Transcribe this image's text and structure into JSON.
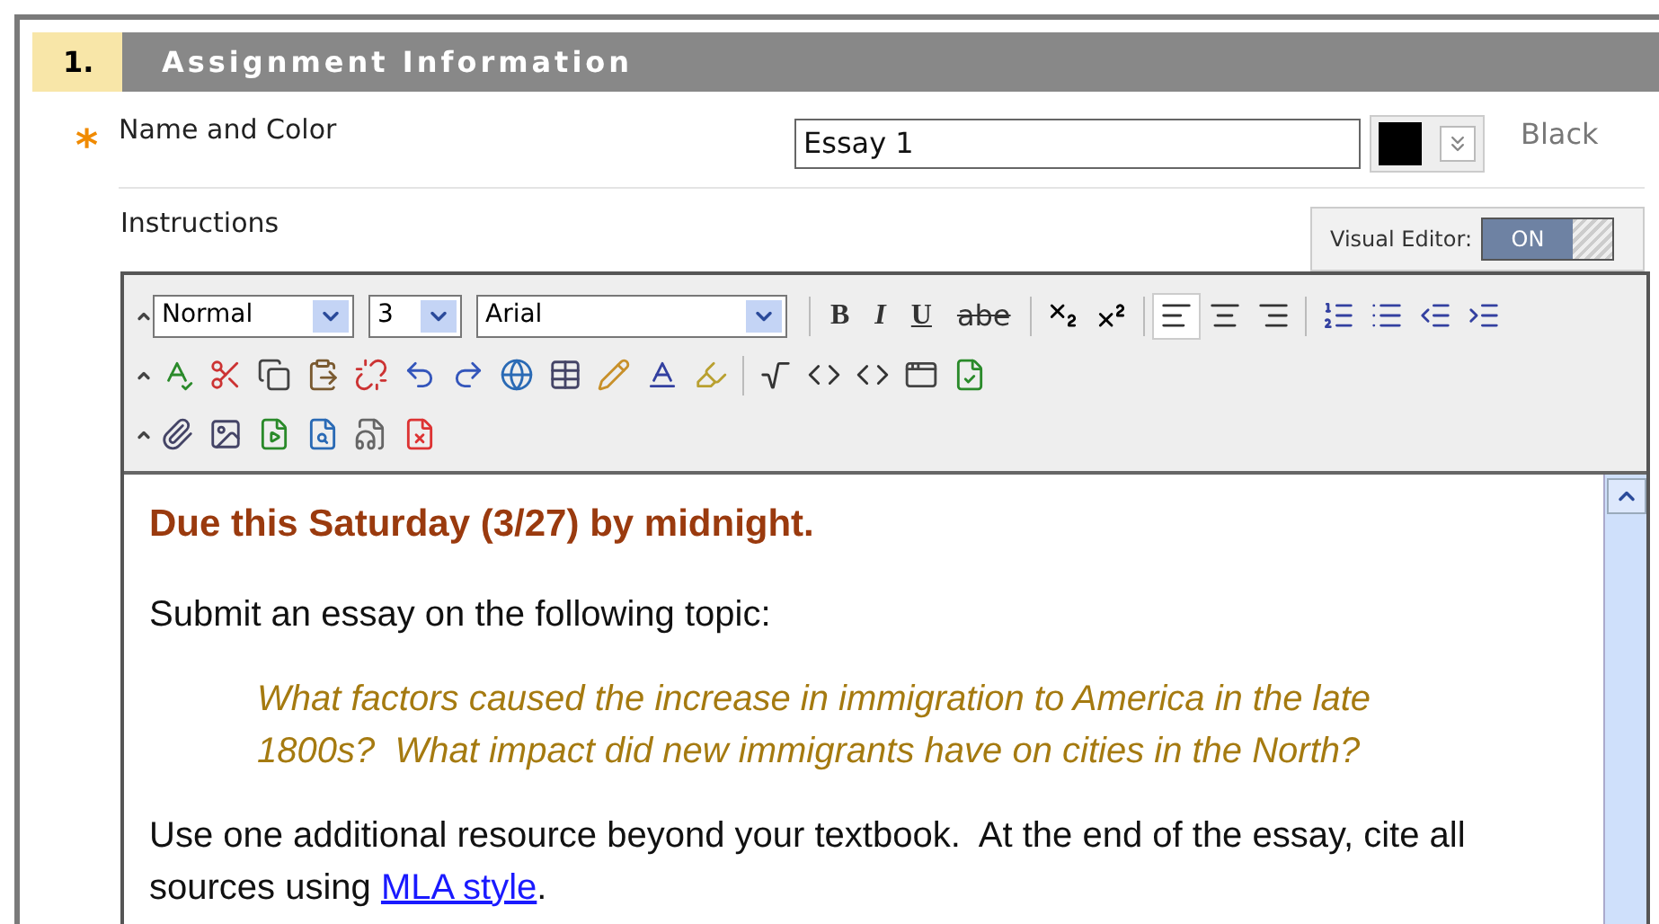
{
  "section": {
    "number": "1.",
    "title": "Assignment Information"
  },
  "name_field": {
    "required_mark": "*",
    "label": "Name and Color",
    "value": "Essay 1",
    "color_name": "Black",
    "color": "#000000"
  },
  "instructions": {
    "label": "Instructions"
  },
  "visual_editor": {
    "label": "Visual Editor:",
    "toggle_text": "ON",
    "on": true
  },
  "toolbar": {
    "rows": [
      [
        {
          "kind": "select",
          "value": "Normal"
        },
        {
          "kind": "select",
          "value": "3"
        },
        {
          "kind": "select",
          "value": "Arial"
        },
        {
          "kind": "sep"
        },
        {
          "kind": "glyph",
          "label": "B"
        },
        {
          "kind": "glyph",
          "label": "I"
        },
        {
          "kind": "glyph",
          "label": "U"
        },
        {
          "kind": "glyph",
          "label": "abe"
        },
        {
          "kind": "sep"
        },
        {
          "kind": "icon"
        },
        {
          "kind": "icon"
        },
        {
          "kind": "sep"
        },
        {
          "kind": "icon",
          "selected": true
        },
        {
          "kind": "icon",
          "selected": false
        },
        {
          "kind": "icon",
          "selected": false
        },
        {
          "kind": "sep"
        },
        {
          "kind": "icon"
        },
        {
          "kind": "icon"
        },
        {
          "kind": "icon"
        },
        {
          "kind": "icon"
        }
      ],
      [
        {
          "kind": "icon"
        },
        {
          "kind": "icon"
        },
        {
          "kind": "icon"
        },
        {
          "kind": "icon"
        },
        {
          "kind": "icon"
        },
        {
          "kind": "icon"
        },
        {
          "kind": "icon"
        },
        {
          "kind": "icon"
        },
        {
          "kind": "icon"
        },
        {
          "kind": "icon"
        },
        {
          "kind": "icon"
        },
        {
          "kind": "icon"
        },
        {
          "kind": "sep"
        },
        {
          "kind": "icon"
        },
        {
          "kind": "icon"
        },
        {
          "kind": "icon"
        },
        {
          "kind": "icon"
        },
        {
          "kind": "icon"
        }
      ],
      [
        {
          "kind": "icon"
        },
        {
          "kind": "icon"
        },
        {
          "kind": "icon"
        },
        {
          "kind": "icon"
        },
        {
          "kind": "icon"
        },
        {
          "kind": "icon"
        }
      ]
    ]
  },
  "content": [
    {
      "kind": "heading",
      "text": "Due this Saturday (3/27) by midnight."
    },
    {
      "kind": "para",
      "text": "Submit an essay on the following topic:"
    },
    {
      "kind": "quote",
      "text": "What factors caused the increase in immigration to America in the late 1800s?  What impact did new immigrants have on cities in the North?"
    },
    {
      "kind": "para",
      "text": "Use one additional resource beyond your textbook.  At the end of the essay, cite all sources using ",
      "link": "MLA style",
      "after": "."
    }
  ]
}
